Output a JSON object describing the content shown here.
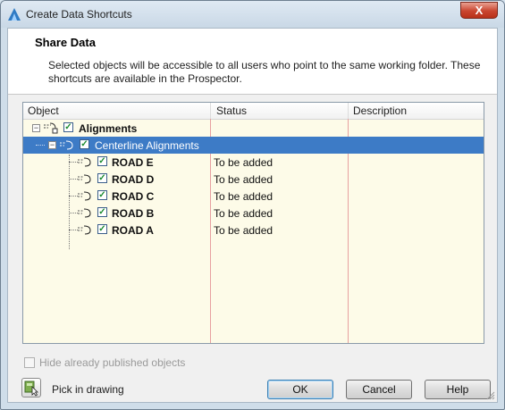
{
  "window": {
    "title": "Create Data Shortcuts",
    "close_label": "X"
  },
  "header": {
    "title": "Share Data",
    "description": "Selected objects will be accessible to all users who point to the same working folder. These shortcuts are available in the Prospector."
  },
  "table": {
    "columns": [
      "Object",
      "Status",
      "Description"
    ],
    "root": {
      "label": "Alignments",
      "checked": true,
      "expanded": true
    },
    "group": {
      "label": "Centerline Alignments",
      "checked": true,
      "expanded": true,
      "selected": true
    },
    "items": [
      {
        "label": "ROAD E",
        "status": "To be added",
        "checked": true
      },
      {
        "label": "ROAD D",
        "status": "To be added",
        "checked": true
      },
      {
        "label": "ROAD C",
        "status": "To be added",
        "checked": true
      },
      {
        "label": "ROAD B",
        "status": "To be added",
        "checked": true
      },
      {
        "label": "ROAD A",
        "status": "To be added",
        "checked": true
      }
    ]
  },
  "options": {
    "hide_published_label": "Hide already published objects",
    "hide_published_checked": false,
    "hide_published_enabled": false
  },
  "footer": {
    "pick_label": "Pick in drawing",
    "ok_label": "OK",
    "cancel_label": "Cancel",
    "help_label": "Help"
  },
  "colors": {
    "selection": "#3d7bc6",
    "panel_bg": "#fdfbe8",
    "column_line": "#e7a0a0",
    "check": "#1a8a2e",
    "close": "#c9452f"
  },
  "icons": {
    "app": "autocad-a-icon",
    "close": "close-icon",
    "alignment": "alignment-icon",
    "pick": "pick-in-drawing-icon"
  }
}
